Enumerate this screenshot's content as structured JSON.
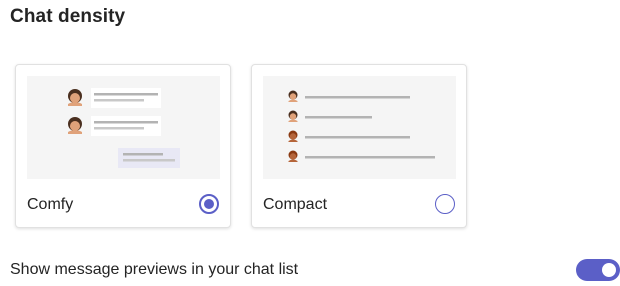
{
  "settings": {
    "title": "Chat density",
    "density_options": [
      {
        "label": "Comfy",
        "selected": true,
        "preview_icon": "comfy-density-illustration"
      },
      {
        "label": "Compact",
        "selected": false,
        "preview_icon": "compact-density-illustration"
      }
    ],
    "message_previews": {
      "label": "Show message previews in your chat list",
      "enabled": true
    }
  },
  "colors": {
    "accent": "#5b5fc7",
    "preview_background": "#f5f5f5",
    "line": "#b3b3b3",
    "hair_dark": "#4a2f1f",
    "skin": "#e0a27a",
    "skin_dark": "#b5653a"
  }
}
